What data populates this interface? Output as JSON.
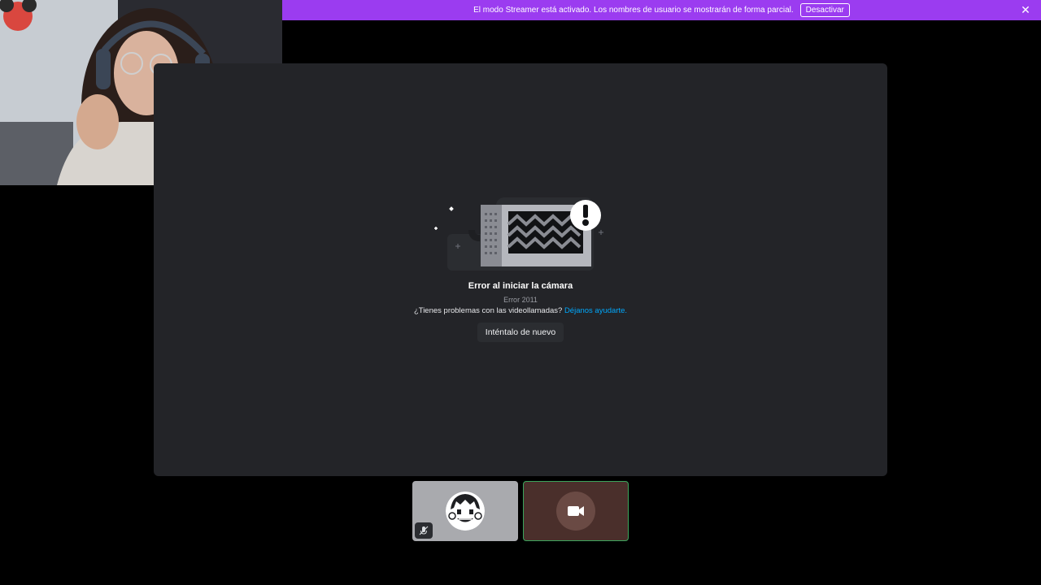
{
  "banner": {
    "text": "El modo Streamer está activado. Los nombres de usuario se mostrarán de forma parcial.",
    "deactivate_label": "Desactivar",
    "close_glyph": "✕",
    "color": "#9b3cf0"
  },
  "stage": {
    "error_title": "Error al iniciar la cámara",
    "error_code": "Error 2011",
    "help_text": "¿Tienes problemas con las videollamadas?",
    "help_link": "Déjanos ayudarte.",
    "retry_label": "Inténtalo de nuevo",
    "link_color": "#00a8fc"
  },
  "participants": [
    {
      "icon": "cartoon-avatar",
      "muted": true,
      "mute_icon": "mic-off-icon"
    },
    {
      "icon": "camera-icon",
      "speaking": true
    }
  ],
  "icons": {
    "banner_close": "close-icon",
    "illustration": "broken-camera-icon"
  }
}
